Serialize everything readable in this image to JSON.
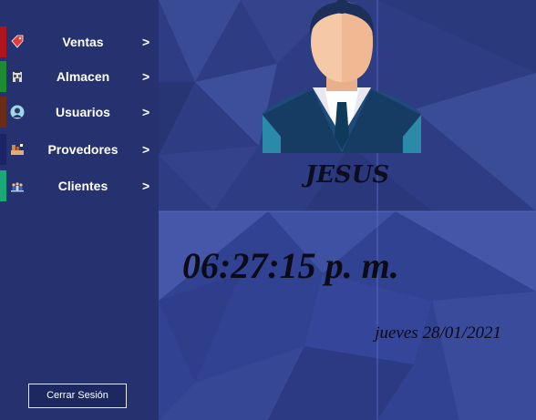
{
  "sidebar": {
    "items": [
      {
        "label": "Ventas",
        "chevron": ">",
        "icon": "sale-tag-icon",
        "stripe_color": "#b0151b"
      },
      {
        "label": "Almacen",
        "chevron": ">",
        "icon": "warehouse-icon",
        "stripe_color": "#1c8a2e"
      },
      {
        "label": "Usuarios",
        "chevron": ">",
        "icon": "user-icon",
        "stripe_color": "#6b2b14"
      },
      {
        "label": "Provedores",
        "chevron": ">",
        "icon": "supplier-icon",
        "stripe_color": "#1a2466"
      },
      {
        "label": "Clientes",
        "chevron": ">",
        "icon": "clients-icon",
        "stripe_color": "#1aa878"
      }
    ],
    "logout_label": "Cerrar Sesión"
  },
  "user": {
    "name": "JESUS",
    "avatar_icon": "businessman-avatar-icon"
  },
  "clock": {
    "time": "06:27:15 p. m.",
    "date": "jueves 28/01/2021"
  },
  "colors": {
    "sidebar": "#25326f",
    "background": "#2d3b82",
    "text_dark": "#0b0b18"
  }
}
